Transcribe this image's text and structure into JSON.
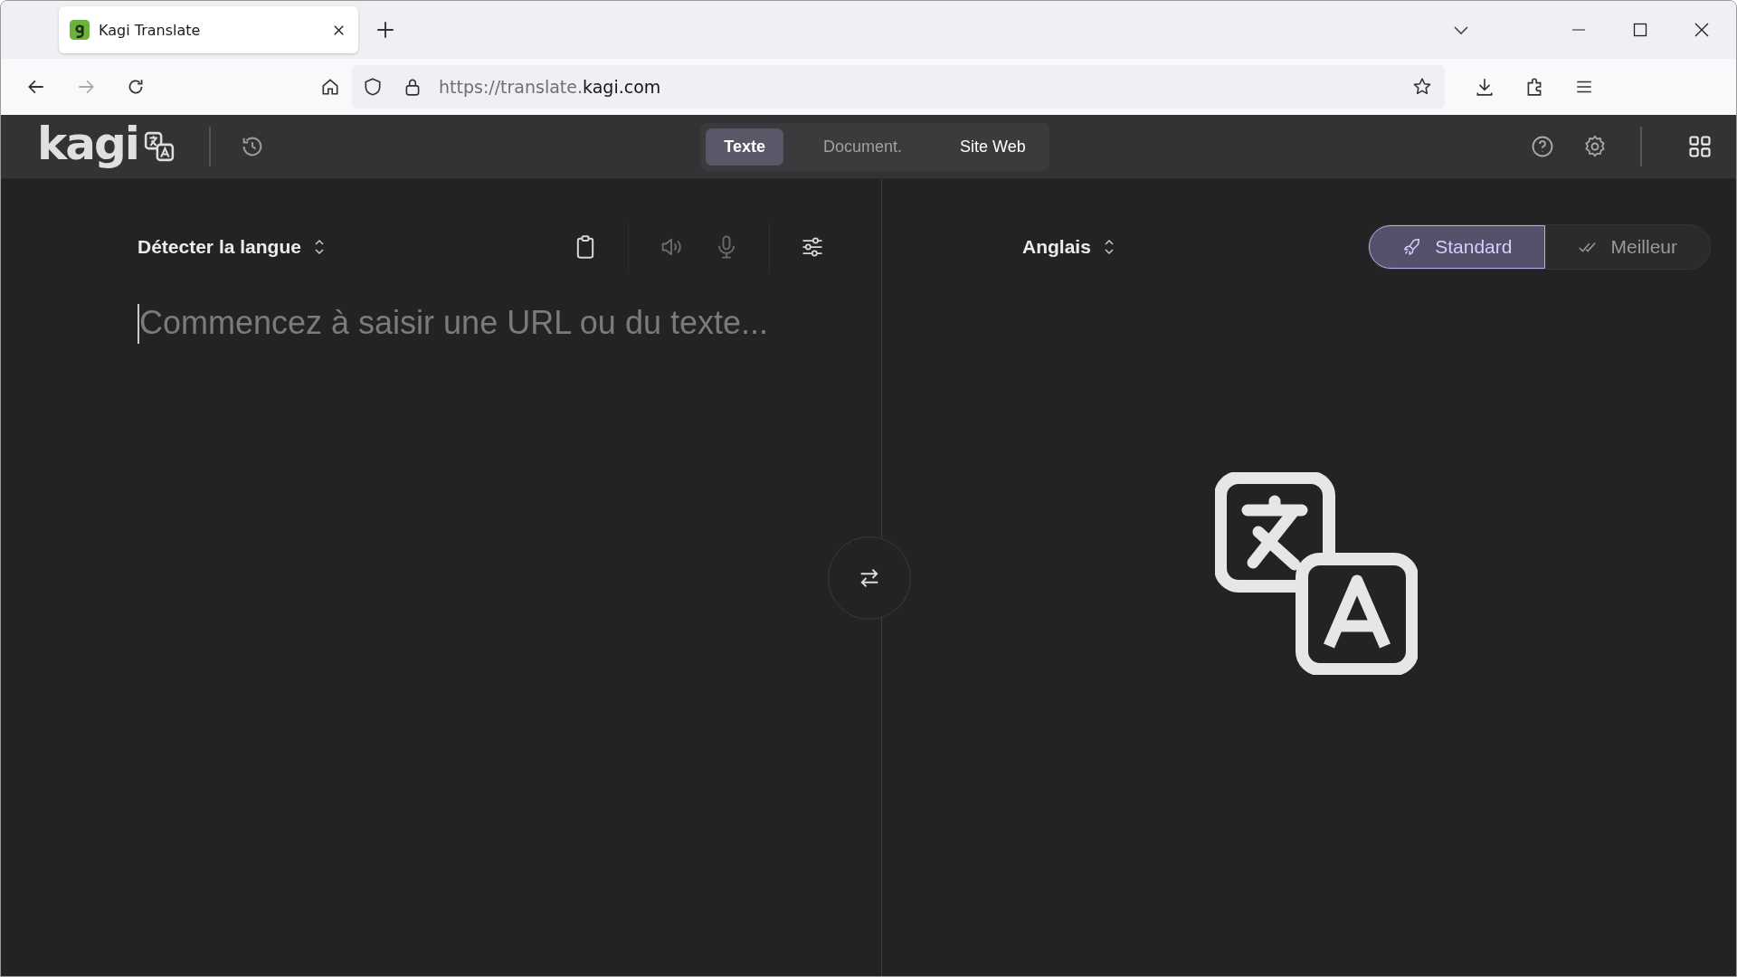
{
  "browser": {
    "tab": {
      "title": "Kagi Translate"
    },
    "address": {
      "prefix": "https://translate.",
      "domain": "kagi.com"
    }
  },
  "app": {
    "logo": "kagi",
    "modes": [
      {
        "label": "Texte",
        "selected": true
      },
      {
        "label": "Document.",
        "selected": false
      },
      {
        "label": "Site Web",
        "selected": false
      }
    ]
  },
  "source": {
    "language": "Détecter la langue",
    "tools": [
      {
        "kind": "clipboard",
        "disabled": false
      },
      {
        "kind": "speaker",
        "disabled": true
      },
      {
        "kind": "microphone",
        "disabled": true
      },
      {
        "kind": "settings",
        "disabled": false
      }
    ],
    "placeholder": "Commencez à saisir une URL ou du texte..."
  },
  "target": {
    "language": "Anglais",
    "quality": [
      {
        "kind": "standard",
        "label": "Standard",
        "selected": true
      },
      {
        "kind": "best",
        "label": "Meilleur",
        "selected": false
      }
    ]
  }
}
